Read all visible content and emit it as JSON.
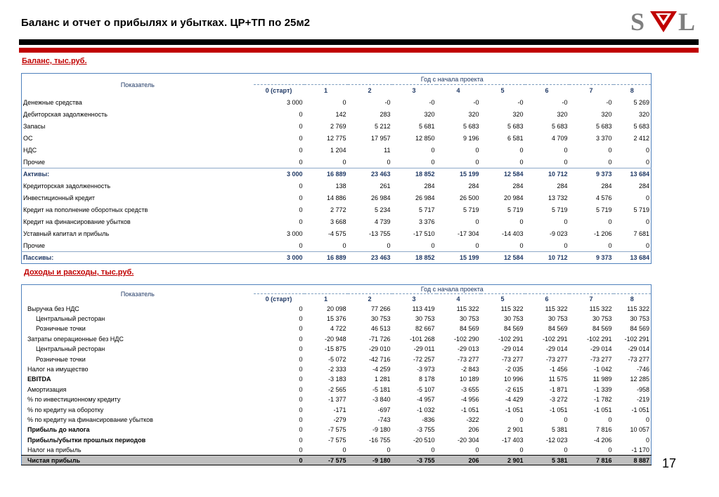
{
  "header": {
    "title": "Баланс и отчет о прибылях и убытках. ЦР+ТП по 25м2",
    "logo_text": "SVL"
  },
  "balance": {
    "section_title": "Баланс, тыс.руб.",
    "col_label": "Показатель",
    "group_label": "Год с начала проекта",
    "columns": [
      "0 (старт)",
      "1",
      "2",
      "3",
      "4",
      "5",
      "6",
      "7",
      "8"
    ],
    "rows": [
      {
        "label": "Денежные средства",
        "values": [
          "3 000",
          "0",
          "-0",
          "-0",
          "-0",
          "-0",
          "-0",
          "-0",
          "5 269"
        ]
      },
      {
        "label": "Дебиторская задолженность",
        "values": [
          "0",
          "142",
          "283",
          "320",
          "320",
          "320",
          "320",
          "320",
          "320"
        ]
      },
      {
        "label": "Запасы",
        "values": [
          "0",
          "2 769",
          "5 212",
          "5 681",
          "5 683",
          "5 683",
          "5 683",
          "5 683",
          "5 683"
        ]
      },
      {
        "label": "ОС",
        "values": [
          "0",
          "12 775",
          "17 957",
          "12 850",
          "9 196",
          "6 581",
          "4 709",
          "3 370",
          "2 412"
        ]
      },
      {
        "label": "НДС",
        "values": [
          "0",
          "1 204",
          "11",
          "0",
          "0",
          "0",
          "0",
          "0",
          "0"
        ]
      },
      {
        "label": "Прочие",
        "values": [
          "0",
          "0",
          "0",
          "0",
          "0",
          "0",
          "0",
          "0",
          "0"
        ]
      },
      {
        "label": "Активы:",
        "values": [
          "3 000",
          "16 889",
          "23 463",
          "18 852",
          "15 199",
          "12 584",
          "10 712",
          "9 373",
          "13 684"
        ]
      },
      {
        "label": "Кредиторская задолженность",
        "values": [
          "0",
          "138",
          "261",
          "284",
          "284",
          "284",
          "284",
          "284",
          "284"
        ]
      },
      {
        "label": "Инвестиционный кредит",
        "values": [
          "0",
          "14 886",
          "26 984",
          "26 984",
          "26 500",
          "20 984",
          "13 732",
          "4 576",
          "0"
        ]
      },
      {
        "label": "Кредит на пополнение оборотных средств",
        "values": [
          "0",
          "2 772",
          "5 234",
          "5 717",
          "5 719",
          "5 719",
          "5 719",
          "5 719",
          "5 719"
        ]
      },
      {
        "label": "Кредит на финансирование убытков",
        "values": [
          "0",
          "3 668",
          "4 739",
          "3 376",
          "0",
          "0",
          "0",
          "0",
          "0"
        ]
      },
      {
        "label": "Уставный капитал и прибыль",
        "values": [
          "3 000",
          "-4 575",
          "-13 755",
          "-17 510",
          "-17 304",
          "-14 403",
          "-9 023",
          "-1 206",
          "7 681"
        ]
      },
      {
        "label": "Прочие",
        "values": [
          "0",
          "0",
          "0",
          "0",
          "0",
          "0",
          "0",
          "0",
          "0"
        ]
      },
      {
        "label": "Пассивы:",
        "values": [
          "3 000",
          "16 889",
          "23 463",
          "18 852",
          "15 199",
          "12 584",
          "10 712",
          "9 373",
          "13 684"
        ]
      }
    ]
  },
  "pnl": {
    "section_title": "Доходы и расходы, тыс.руб.",
    "col_label": "Показатель",
    "group_label": "Год с начала проекта",
    "columns": [
      "0 (старт)",
      "1",
      "2",
      "3",
      "4",
      "5",
      "6",
      "7",
      "8"
    ],
    "rows": [
      {
        "label": "Выручка без НДС",
        "values": [
          "0",
          "20 098",
          "77 266",
          "113 419",
          "115 322",
          "115 322",
          "115 322",
          "115 322",
          "115 322"
        ]
      },
      {
        "label": "Центральный ресторан",
        "values": [
          "0",
          "15 376",
          "30 753",
          "30 753",
          "30 753",
          "30 753",
          "30 753",
          "30 753",
          "30 753"
        ]
      },
      {
        "label": "Розничные точки",
        "values": [
          "0",
          "4 722",
          "46 513",
          "82 667",
          "84 569",
          "84 569",
          "84 569",
          "84 569",
          "84 569"
        ]
      },
      {
        "label": "Затраты операционные без НДС",
        "values": [
          "0",
          "-20 948",
          "-71 726",
          "-101 268",
          "-102 290",
          "-102 291",
          "-102 291",
          "-102 291",
          "-102 291"
        ]
      },
      {
        "label": "Центральный ресторан",
        "values": [
          "0",
          "-15 875",
          "-29 010",
          "-29 011",
          "-29 013",
          "-29 014",
          "-29 014",
          "-29 014",
          "-29 014"
        ]
      },
      {
        "label": "Розничные точки",
        "values": [
          "0",
          "-5 072",
          "-42 716",
          "-72 257",
          "-73 277",
          "-73 277",
          "-73 277",
          "-73 277",
          "-73 277"
        ]
      },
      {
        "label": "Налог на имущество",
        "values": [
          "0",
          "-2 333",
          "-4 259",
          "-3 973",
          "-2 843",
          "-2 035",
          "-1 456",
          "-1 042",
          "-746"
        ]
      },
      {
        "label": "EBITDA",
        "values": [
          "0",
          "-3 183",
          "1 281",
          "8 178",
          "10 189",
          "10 996",
          "11 575",
          "11 989",
          "12 285"
        ]
      },
      {
        "label": "Амортизация",
        "values": [
          "0",
          "-2 565",
          "-5 181",
          "-5 107",
          "-3 655",
          "-2 615",
          "-1 871",
          "-1 339",
          "-958"
        ]
      },
      {
        "label": "% по инвестиционному кредиту",
        "values": [
          "0",
          "-1 377",
          "-3 840",
          "-4 957",
          "-4 956",
          "-4 429",
          "-3 272",
          "-1 782",
          "-219"
        ]
      },
      {
        "label": "% по кредиту на оборотку",
        "values": [
          "0",
          "-171",
          "-697",
          "-1 032",
          "-1 051",
          "-1 051",
          "-1 051",
          "-1 051",
          "-1 051"
        ]
      },
      {
        "label": "% по кредиту на финансирование убытков",
        "values": [
          "0",
          "-279",
          "-743",
          "-836",
          "-322",
          "0",
          "0",
          "0",
          "0"
        ]
      },
      {
        "label": "Прибыль до налога",
        "values": [
          "0",
          "-7 575",
          "-9 180",
          "-3 755",
          "206",
          "2 901",
          "5 381",
          "7 816",
          "10 057"
        ]
      },
      {
        "label": "Прибыль/убытки прошлых периодов",
        "values": [
          "0",
          "-7 575",
          "-16 755",
          "-20 510",
          "-20 304",
          "-17 403",
          "-12 023",
          "-4 206",
          "0"
        ]
      },
      {
        "label": "Налог на прибыль",
        "values": [
          "0",
          "0",
          "0",
          "0",
          "0",
          "0",
          "0",
          "0",
          "-1 170"
        ]
      },
      {
        "label": "Чистая прибыль",
        "values": [
          "0",
          "-7 575",
          "-9 180",
          "-3 755",
          "206",
          "2 901",
          "5 381",
          "7 816",
          "8 887"
        ]
      }
    ]
  },
  "footer": {
    "page_number": "17"
  }
}
